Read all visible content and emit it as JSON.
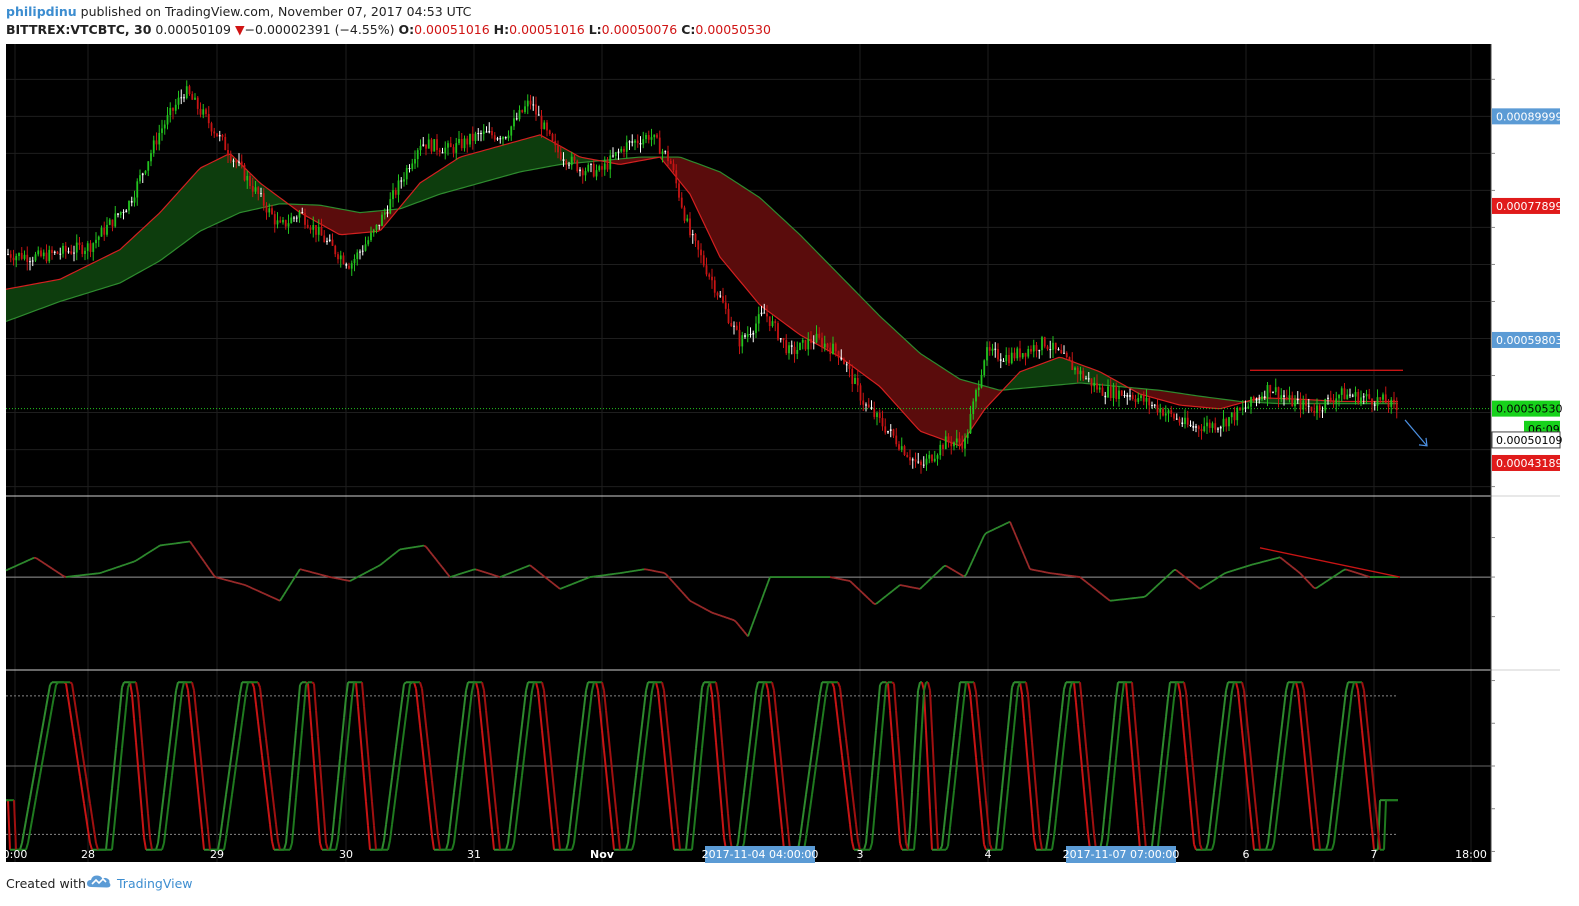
{
  "header": {
    "author": "philipdinu",
    "published_text": "published on TradingView.com, November 07, 2017 04:53 UTC",
    "symbol": "BITTREX:VTCBTC, 30",
    "last": "0.00050109",
    "change_arrow": "▼",
    "change": "−0.00002391 (−4.55%)",
    "o_label": "O:",
    "o_value": "0.00051016",
    "h_label": "H:",
    "h_value": "0.00051016",
    "l_label": "L:",
    "l_value": "0.00050076",
    "c_label": "C:",
    "c_value": "0.00050530"
  },
  "footer": {
    "created_with": "Created with",
    "brand": "TradingView",
    "logo_icon": "cloud-logo-icon"
  },
  "colors": {
    "background": "#000000",
    "bull": "#22c41e",
    "bear": "#c81414",
    "ribbon_green": "#0d3d0d",
    "ribbon_red": "#5a0c0c",
    "ma_fast": "#d42020",
    "ma_slow": "#2e8b2e",
    "price_tag_blue": "#5b9bd5",
    "price_tag_red": "#e01b1b",
    "price_tag_green": "#17d21b",
    "annotation_blue": "#4b8fe0",
    "grid": "#1e1e1e"
  },
  "chart_data": [
    {
      "type": "candlestick",
      "timeframe": "30",
      "ylim": [
        0.00039,
        0.000995
      ],
      "yticks": [
        "0.00095000",
        "0.00085000",
        "0.00080000",
        "0.00075000",
        "0.00070000",
        "0.00065000",
        "0.00055000",
        "0.00040000"
      ],
      "price_tags": [
        {
          "value": 0.00089999,
          "label": "0.00089999",
          "color": "blue"
        },
        {
          "value": 0.00077899,
          "label": "0.00077899",
          "color": "red"
        },
        {
          "value": 0.00059803,
          "label": "0.00059803",
          "color": "blue"
        },
        {
          "value": 0.0005053,
          "label": "0.00050530",
          "color": "green"
        },
        {
          "value": 0.000478,
          "label": "06:09",
          "color": "green"
        },
        {
          "value": 0.000463,
          "label": "0.00050109",
          "color": "white"
        },
        {
          "value": 0.00043189,
          "label": "0.00043189",
          "color": "red"
        }
      ],
      "price_path": [
        [
          0,
          0.000715
        ],
        [
          40,
          0.00071
        ],
        [
          90,
          0.000725
        ],
        [
          130,
          0.000785
        ],
        [
          160,
          0.00088
        ],
        [
          185,
          0.000935
        ],
        [
          210,
          0.00089
        ],
        [
          240,
          0.00083
        ],
        [
          260,
          0.00079
        ],
        [
          280,
          0.00075
        ],
        [
          300,
          0.00077
        ],
        [
          330,
          0.000725
        ],
        [
          350,
          0.0007
        ],
        [
          375,
          0.000745
        ],
        [
          400,
          0.00081
        ],
        [
          420,
          0.000865
        ],
        [
          450,
          0.000855
        ],
        [
          480,
          0.000875
        ],
        [
          505,
          0.000875
        ],
        [
          530,
          0.00092
        ],
        [
          555,
          0.000855
        ],
        [
          580,
          0.00083
        ],
        [
          600,
          0.000825
        ],
        [
          625,
          0.00086
        ],
        [
          650,
          0.000875
        ],
        [
          670,
          0.00084
        ],
        [
          690,
          0.00074
        ],
        [
          715,
          0.00067
        ],
        [
          740,
          0.000595
        ],
        [
          765,
          0.000635
        ],
        [
          790,
          0.00058
        ],
        [
          815,
          0.0006
        ],
        [
          840,
          0.00058
        ],
        [
          865,
          0.00051
        ],
        [
          895,
          0.000465
        ],
        [
          920,
          0.000425
        ],
        [
          945,
          0.00046
        ],
        [
          965,
          0.00046
        ],
        [
          985,
          0.00058
        ],
        [
          1010,
          0.000575
        ],
        [
          1045,
          0.000595
        ],
        [
          1070,
          0.000565
        ],
        [
          1100,
          0.00053
        ],
        [
          1130,
          0.000525
        ],
        [
          1160,
          0.000505
        ],
        [
          1190,
          0.00048
        ],
        [
          1220,
          0.000485
        ],
        [
          1245,
          0.000505
        ],
        [
          1270,
          0.000535
        ],
        [
          1290,
          0.000515
        ],
        [
          1315,
          0.000505
        ],
        [
          1340,
          0.000525
        ],
        [
          1365,
          0.00052
        ],
        [
          1385,
          0.000515
        ],
        [
          1398,
          0.000503
        ]
      ],
      "ma_fast_path": [
        [
          0,
          0.000665
        ],
        [
          60,
          0.00068
        ],
        [
          120,
          0.00072
        ],
        [
          160,
          0.00077
        ],
        [
          200,
          0.00083
        ],
        [
          230,
          0.00085
        ],
        [
          260,
          0.00081
        ],
        [
          300,
          0.00077
        ],
        [
          340,
          0.00074
        ],
        [
          380,
          0.000745
        ],
        [
          420,
          0.00081
        ],
        [
          460,
          0.000845
        ],
        [
          500,
          0.00086
        ],
        [
          540,
          0.000875
        ],
        [
          580,
          0.000845
        ],
        [
          620,
          0.000835
        ],
        [
          660,
          0.000845
        ],
        [
          690,
          0.000795
        ],
        [
          720,
          0.00071
        ],
        [
          760,
          0.000645
        ],
        [
          800,
          0.000605
        ],
        [
          840,
          0.000575
        ],
        [
          880,
          0.000535
        ],
        [
          920,
          0.000475
        ],
        [
          960,
          0.000455
        ],
        [
          985,
          0.000505
        ],
        [
          1020,
          0.000555
        ],
        [
          1060,
          0.000575
        ],
        [
          1100,
          0.000555
        ],
        [
          1140,
          0.000525
        ],
        [
          1180,
          0.00051
        ],
        [
          1220,
          0.000505
        ],
        [
          1260,
          0.00052
        ],
        [
          1300,
          0.000518
        ],
        [
          1340,
          0.000515
        ],
        [
          1398,
          0.000515
        ]
      ],
      "ma_slow_path": [
        [
          0,
          0.00062
        ],
        [
          60,
          0.00065
        ],
        [
          120,
          0.000675
        ],
        [
          160,
          0.000705
        ],
        [
          200,
          0.000745
        ],
        [
          240,
          0.00077
        ],
        [
          280,
          0.000782
        ],
        [
          320,
          0.00078
        ],
        [
          360,
          0.00077
        ],
        [
          400,
          0.000775
        ],
        [
          440,
          0.000795
        ],
        [
          480,
          0.00081
        ],
        [
          520,
          0.000825
        ],
        [
          560,
          0.000835
        ],
        [
          600,
          0.00084
        ],
        [
          640,
          0.000845
        ],
        [
          680,
          0.000845
        ],
        [
          720,
          0.000825
        ],
        [
          760,
          0.00079
        ],
        [
          800,
          0.00074
        ],
        [
          840,
          0.000685
        ],
        [
          880,
          0.00063
        ],
        [
          920,
          0.00058
        ],
        [
          960,
          0.000545
        ],
        [
          1000,
          0.00053
        ],
        [
          1040,
          0.000535
        ],
        [
          1080,
          0.00054
        ],
        [
          1120,
          0.000535
        ],
        [
          1160,
          0.00053
        ],
        [
          1200,
          0.000522
        ],
        [
          1240,
          0.000515
        ],
        [
          1280,
          0.000512
        ],
        [
          1320,
          0.000512
        ],
        [
          1398,
          0.000512
        ]
      ],
      "resistance_line": [
        [
          1250,
          0.000557
        ],
        [
          1403,
          0.000557
        ]
      ],
      "forecast_arrow": [
        [
          1405,
          0.00049
        ],
        [
          1427,
          0.000455
        ]
      ]
    },
    {
      "type": "line",
      "name": "oscillator",
      "ylim": [
        -1.15,
        1.0
      ],
      "yticks": [
        "0.500",
        "0.000",
        "-0.500"
      ],
      "path": [
        [
          0,
          0.05
        ],
        [
          35,
          0.25
        ],
        [
          65,
          0.0
        ],
        [
          100,
          0.05
        ],
        [
          135,
          0.2
        ],
        [
          160,
          0.4
        ],
        [
          190,
          0.45
        ],
        [
          215,
          0.0
        ],
        [
          245,
          -0.1
        ],
        [
          280,
          -0.3
        ],
        [
          300,
          0.1
        ],
        [
          330,
          0.0
        ],
        [
          350,
          -0.05
        ],
        [
          380,
          0.15
        ],
        [
          400,
          0.35
        ],
        [
          425,
          0.4
        ],
        [
          450,
          0.0
        ],
        [
          475,
          0.1
        ],
        [
          500,
          0.0
        ],
        [
          530,
          0.15
        ],
        [
          560,
          -0.15
        ],
        [
          590,
          0.0
        ],
        [
          620,
          0.05
        ],
        [
          645,
          0.1
        ],
        [
          665,
          0.05
        ],
        [
          690,
          -0.3
        ],
        [
          712,
          -0.45
        ],
        [
          735,
          -0.55
        ],
        [
          748,
          -0.75
        ],
        [
          770,
          0.0
        ],
        [
          800,
          0.0
        ],
        [
          830,
          0.0
        ],
        [
          850,
          -0.05
        ],
        [
          875,
          -0.35
        ],
        [
          900,
          -0.1
        ],
        [
          920,
          -0.15
        ],
        [
          945,
          0.15
        ],
        [
          965,
          0.0
        ],
        [
          985,
          0.55
        ],
        [
          1010,
          0.7
        ],
        [
          1030,
          0.1
        ],
        [
          1050,
          0.05
        ],
        [
          1080,
          0.0
        ],
        [
          1110,
          -0.3
        ],
        [
          1145,
          -0.25
        ],
        [
          1175,
          0.1
        ],
        [
          1200,
          -0.15
        ],
        [
          1225,
          0.05
        ],
        [
          1250,
          0.15
        ],
        [
          1280,
          0.25
        ],
        [
          1300,
          0.05
        ],
        [
          1315,
          -0.15
        ],
        [
          1345,
          0.1
        ],
        [
          1370,
          0.0
        ],
        [
          1398,
          0.0
        ]
      ],
      "trend_line": [
        [
          1260,
          0.37
        ],
        [
          1400,
          0.0
        ]
      ]
    },
    {
      "type": "line",
      "name": "stochastic",
      "ylim": [
        -1.1,
        1.1
      ],
      "yticks": [
        "1.000",
        "0.500",
        "0.000",
        "-0.500",
        "-1.000"
      ],
      "upper_level": 0.82,
      "lower_level": -0.8,
      "cycles_x": [
        10,
        100,
        150,
        210,
        280,
        325,
        375,
        440,
        500,
        560,
        620,
        680,
        730,
        790,
        860,
        905,
        935,
        990,
        1040,
        1095,
        1145,
        1200,
        1260,
        1320,
        1380
      ]
    }
  ],
  "x_axis": {
    "labels": [
      {
        "x": 15,
        "label": "0:00"
      },
      {
        "x": 88,
        "label": "28"
      },
      {
        "x": 217,
        "label": "29"
      },
      {
        "x": 346,
        "label": "30"
      },
      {
        "x": 474,
        "label": "31"
      },
      {
        "x": 602,
        "label": "Nov"
      },
      {
        "x": 860,
        "label": "3"
      },
      {
        "x": 988,
        "label": "4"
      },
      {
        "x": 1246,
        "label": "6"
      },
      {
        "x": 1374,
        "label": "7"
      },
      {
        "x": 1471,
        "label": "18:00"
      }
    ],
    "highlight_labels": [
      {
        "x": 760,
        "label": "2017-11-04 04:00:00"
      },
      {
        "x": 1121,
        "label": "2017-11-07 07:00:00"
      }
    ]
  }
}
